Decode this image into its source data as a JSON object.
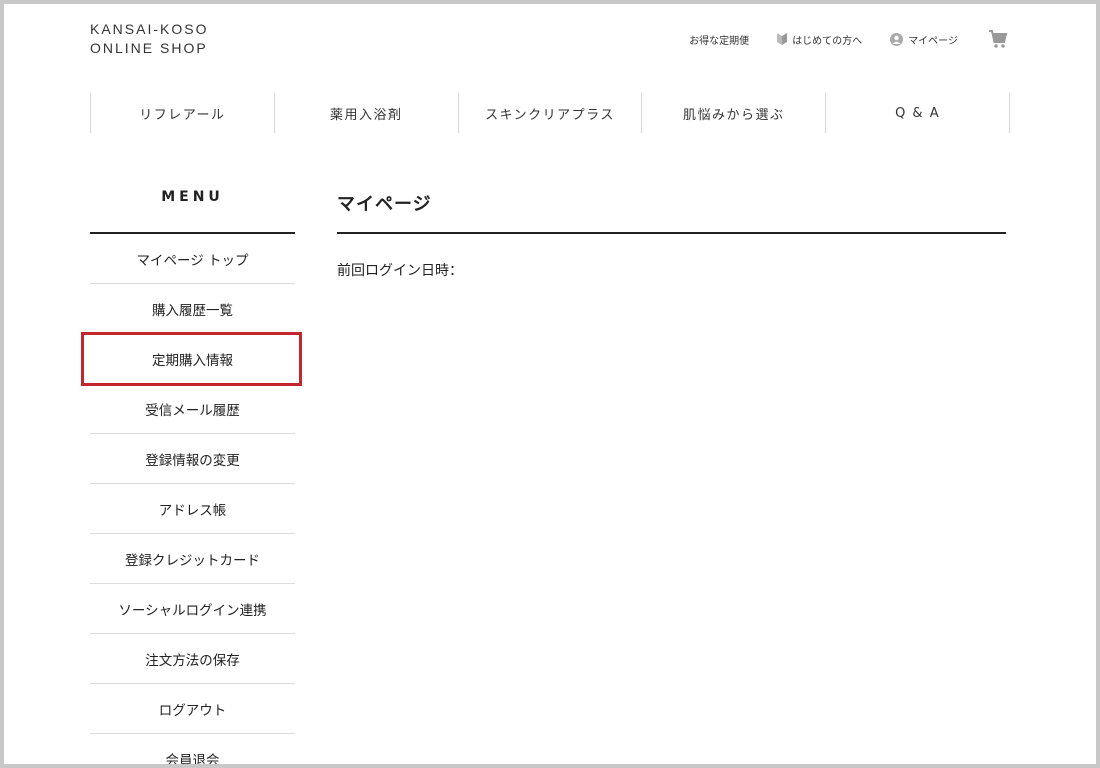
{
  "logo": {
    "line1": "KANSAI-KOSO",
    "line2": "ONLINE SHOP"
  },
  "util_nav": {
    "subscription": "お得な定期便",
    "first_time": "はじめての方へ",
    "mypage": "マイページ",
    "cart_icon": "cart-icon"
  },
  "global_nav": [
    {
      "label": "リフレアール"
    },
    {
      "label": "薬用入浴剤"
    },
    {
      "label": "スキンクリアプラス"
    },
    {
      "label": "肌悩みから選ぶ"
    },
    {
      "label": "Q & A"
    }
  ],
  "sidebar": {
    "title": "MENU",
    "items": [
      {
        "label": "マイページ トップ"
      },
      {
        "label": "購入履歴一覧"
      },
      {
        "label": "定期購入情報"
      },
      {
        "label": "受信メール履歴"
      },
      {
        "label": "登録情報の変更"
      },
      {
        "label": "アドレス帳"
      },
      {
        "label": "登録クレジットカード"
      },
      {
        "label": "ソーシャルログイン連携"
      },
      {
        "label": "注文方法の保存"
      },
      {
        "label": "ログアウト"
      },
      {
        "label": "会員退会"
      }
    ],
    "highlighted_index": 2,
    "highlight_color": "#c1272d"
  },
  "main": {
    "title": "マイページ",
    "last_login_label": "前回ログイン日時："
  }
}
